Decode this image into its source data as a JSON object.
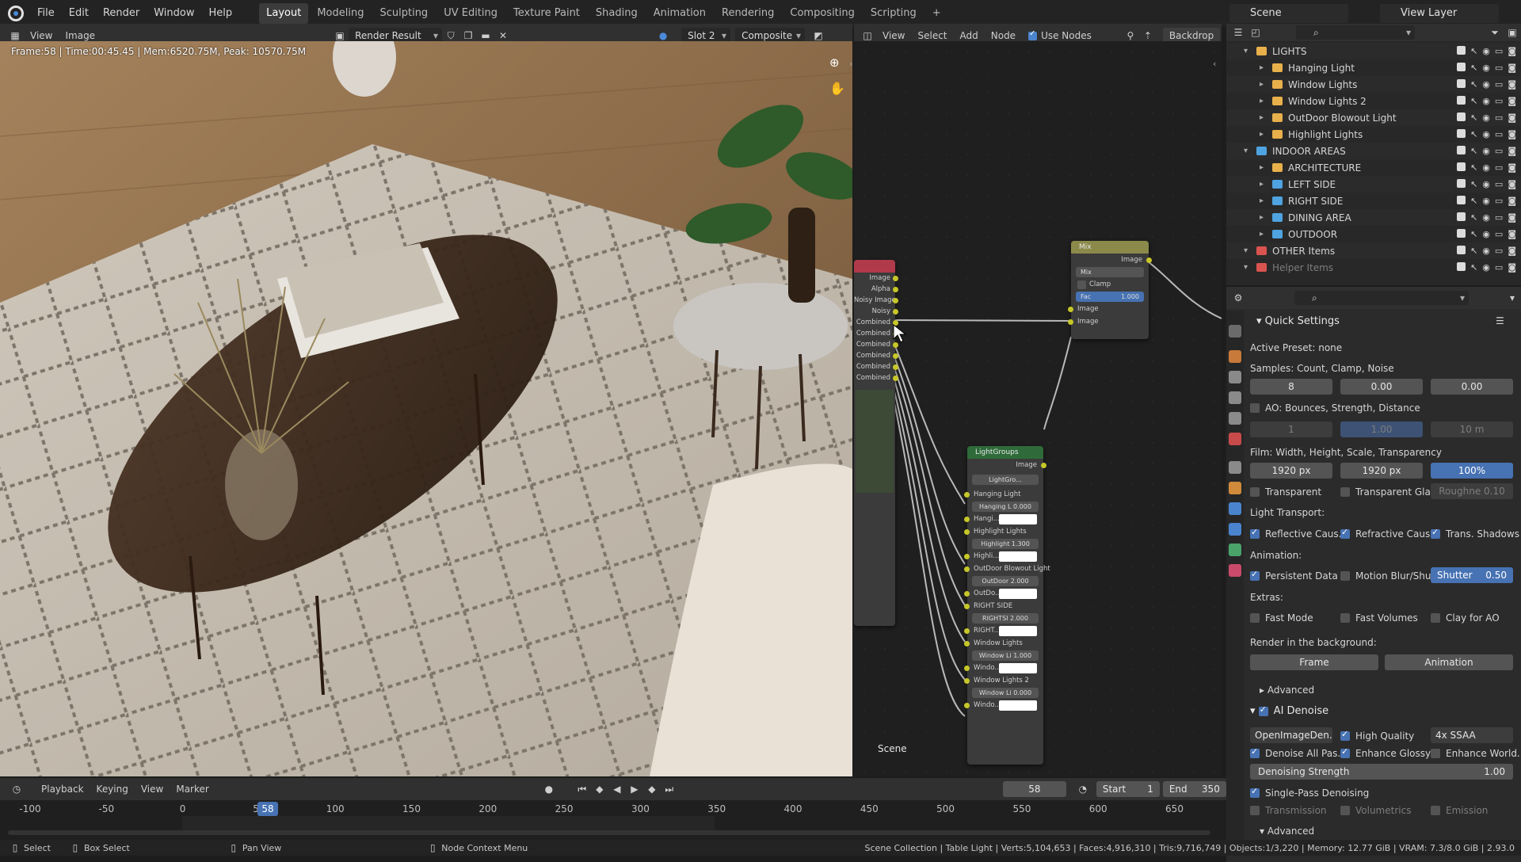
{
  "top_menu": [
    "File",
    "Edit",
    "Render",
    "Window",
    "Help"
  ],
  "workspaces": [
    "Layout",
    "Modeling",
    "Sculpting",
    "UV Editing",
    "Texture Paint",
    "Shading",
    "Animation",
    "Rendering",
    "Compositing",
    "Scripting"
  ],
  "active_workspace": "Layout",
  "add_workspace": "+",
  "scene_name": "Scene",
  "view_layer": "View Layer",
  "image_editor": {
    "menus": [
      "View",
      "Image"
    ],
    "image_name": "Render Result",
    "slot": "Slot 2",
    "pass": "Composite",
    "stats": "Frame:58 | Time:00:45.45 | Mem:6520.75M, Peak: 10570.75M"
  },
  "node_editor": {
    "menus": [
      "View",
      "Select",
      "Add",
      "Node"
    ],
    "use_nodes_label": "Use Nodes",
    "backdrop_label": "Backdrop",
    "scene_label": "Scene",
    "render_layers_sockets": [
      "Image",
      "Alpha",
      "Noisy Image",
      "Noisy",
      "Combined",
      "Combined",
      "Combined",
      "Combined",
      "Combined",
      "Combined"
    ],
    "mix_node": {
      "title": "Mix",
      "output": "Image",
      "blend": "Mix",
      "clamp": "Clamp",
      "fac_label": "Fac",
      "fac_value": "1.000",
      "inputs": [
        "Image",
        "Image"
      ]
    },
    "light_groups_node": {
      "title": "LightGroups",
      "output": "Image",
      "group_select": "LightGro...",
      "rows": [
        {
          "label": "Hanging Light",
          "field": "Hanging L 0.000",
          "color_label": "Hangi..."
        },
        {
          "label": "Highlight Lights",
          "field": "Highlight 1.300",
          "color_label": "Highli..."
        },
        {
          "label": "OutDoor Blowout Light",
          "field": "OutDoor 2.000",
          "color_label": "OutDo..."
        },
        {
          "label": "RIGHT SIDE",
          "field": "RIGHTSI 2.000",
          "color_label": "RIGHT..."
        },
        {
          "label": "Window Lights",
          "field": "Window Li 1.000",
          "color_label": "Windo..."
        },
        {
          "label": "Window Lights 2",
          "field": "Window Li 0.000",
          "color_label": "Windo..."
        }
      ]
    }
  },
  "outliner": {
    "rows": [
      {
        "name": "LIGHTS",
        "indent": 0,
        "color": "#e8b04b"
      },
      {
        "name": "Hanging Light",
        "indent": 1,
        "color": "#e8b04b"
      },
      {
        "name": "Window Lights",
        "indent": 1,
        "color": "#e8b04b"
      },
      {
        "name": "Window Lights 2",
        "indent": 1,
        "color": "#e8b04b"
      },
      {
        "name": "OutDoor Blowout Light",
        "indent": 1,
        "color": "#e8b04b"
      },
      {
        "name": "Highlight Lights",
        "indent": 1,
        "color": "#e8b04b"
      },
      {
        "name": "INDOOR AREAS",
        "indent": 0,
        "color": "#4fa3e0"
      },
      {
        "name": "ARCHITECTURE",
        "indent": 1,
        "color": "#e8b04b"
      },
      {
        "name": "LEFT SIDE",
        "indent": 1,
        "color": "#4fa3e0"
      },
      {
        "name": "RIGHT SIDE",
        "indent": 1,
        "color": "#4fa3e0"
      },
      {
        "name": "DINING AREA",
        "indent": 1,
        "color": "#4fa3e0"
      },
      {
        "name": "OUTDOOR",
        "indent": 1,
        "color": "#4fa3e0"
      },
      {
        "name": "OTHER Items",
        "indent": 0,
        "color": "#d9534f"
      },
      {
        "name": "Helper Items",
        "indent": 0,
        "color": "#d9534f"
      }
    ]
  },
  "properties": {
    "panel_title": "Quick Settings",
    "active_preset": "Active Preset: none",
    "samples_label": "Samples: Count, Clamp, Noise",
    "samples": [
      "8",
      "0.00",
      "0.00"
    ],
    "ao_label": "AO: Bounces, Strength, Distance",
    "ao_values": [
      "1",
      "1.00",
      "10 m"
    ],
    "film_label": "Film: Width, Height, Scale, Transparency",
    "film_values": [
      "1920 px",
      "1920 px",
      "100%"
    ],
    "transparent": "Transparent",
    "transparent_glass": "Transparent Gla...",
    "roughness": "Roughne   0.10",
    "light_transport": "Light Transport:",
    "reflective": "Reflective Caus...",
    "refractive": "Refractive Caus...",
    "trans_shadows": "Trans. Shadows",
    "animation_label": "Animation:",
    "persistent": "Persistent Data",
    "motion_blur": "Motion Blur/Shu...",
    "shutter_label": "Shutter",
    "shutter_value": "0.50",
    "extras_label": "Extras:",
    "fast_mode": "Fast Mode",
    "fast_volumes": "Fast Volumes",
    "clay_ao": "Clay for AO",
    "background_label": "Render in the background:",
    "frame_btn": "Frame",
    "animation_btn": "Animation",
    "advanced": "Advanced",
    "ai_denoise": "AI Denoise",
    "denoiser": "OpenImageDen...",
    "high_quality": "High Quality",
    "ssaa": "4x SSAA",
    "denoise_all": "Denoise All Pas...",
    "enhance_glossy": "Enhance Glossy",
    "enhance_world": "Enhance World...",
    "denoising_strength_label": "Denoising Strength",
    "denoising_strength_value": "1.00",
    "single_pass": "Single-Pass Denoising",
    "transmission": "Transmission",
    "volumetrics": "Volumetrics",
    "emission": "Emission",
    "advanced2": "Advanced"
  },
  "timeline": {
    "menus": [
      "Playback",
      "Keying",
      "View",
      "Marker"
    ],
    "current_frame": "58",
    "start_label": "Start",
    "start": "1",
    "end_label": "End",
    "end": "350",
    "ticks": [
      "-100",
      "-50",
      "0",
      "50",
      "100",
      "150",
      "200",
      "250",
      "300",
      "350",
      "400",
      "450",
      "500",
      "550",
      "600",
      "650"
    ],
    "playhead": "58"
  },
  "statusbar": {
    "select": "Select",
    "box_select": "Box Select",
    "pan_view": "Pan View",
    "node_context": "Node Context Menu",
    "stats": "Scene Collection | Table Light | Verts:5,104,653 | Faces:4,916,310 | Tris:9,716,749 | Objects:1/3,220 | Memory: 12.77 GiB | VRAM: 7.3/8.0 GiB | 2.93.0"
  }
}
